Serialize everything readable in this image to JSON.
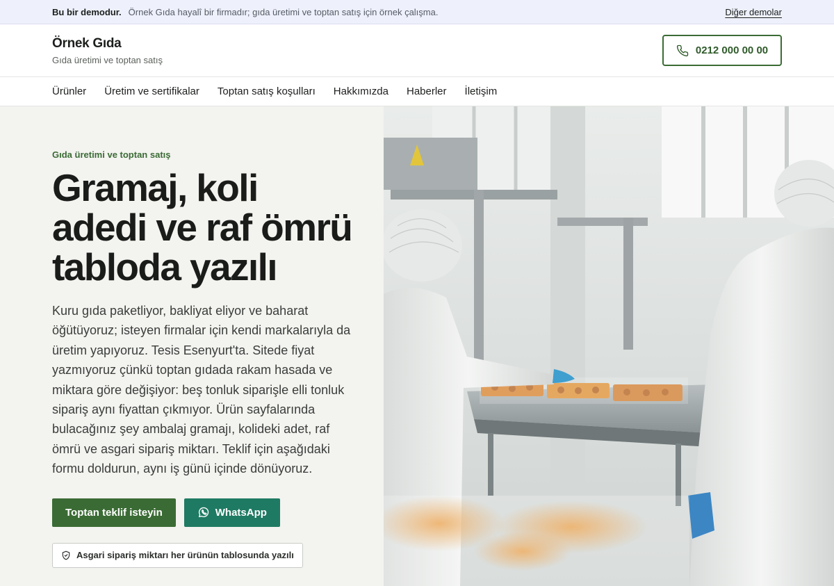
{
  "demo_bar": {
    "label": "Bu bir demodur.",
    "note": "Örnek Gıda hayalî bir firmadır; gıda üretimi ve toptan satış için örnek çalışma.",
    "link": "Diğer demolar"
  },
  "header": {
    "brand_name": "Örnek Gıda",
    "brand_tagline": "Gıda üretimi ve toptan satış",
    "phone": "0212 000 00 00",
    "phone_icon": "phone-icon"
  },
  "nav": {
    "items": [
      {
        "label": "Ürünler"
      },
      {
        "label": "Üretim ve sertifikalar"
      },
      {
        "label": "Toptan satış koşulları"
      },
      {
        "label": "Hakkımızda"
      },
      {
        "label": "Haberler"
      },
      {
        "label": "İletişim"
      }
    ]
  },
  "hero": {
    "eyebrow": "Gıda üretimi ve toptan satış",
    "headline": "Gramaj, koli adedi ve raf ömrü tabloda yazılı",
    "lead": "Kuru gıda paketliyor, bakliyat eliyor ve baharat öğütüyoruz; isteyen firmalar için kendi markalarıyla da üretim yapıyoruz. Tesis Esenyurt'ta. Sitede fiyat yazmıyoruz çünkü toptan gıdada rakam hasada ve miktara göre değişiyor: beş tonluk siparişle elli tonluk sipariş aynı fiyattan çıkmıyor. Ürün sayfalarında bulacağınız şey ambalaj gramajı, kolideki adet, raf ömrü ve asgari sipariş miktarı. Teklif için aşağıdaki formu doldurun, aynı iş günü içinde dönüyoruz.",
    "cta_primary": "Toptan teklif isteyin",
    "cta_whatsapp": "WhatsApp",
    "badge": "Asgari sipariş miktarı her ürünün tablosunda yazılı",
    "image_subject": "factory-workers-production-line-photo"
  },
  "colors": {
    "brand_green": "#3a6b34",
    "whatsapp_teal": "#1f7a63",
    "demo_bar_bg": "#eef1fb",
    "hero_bg": "#f3f3f0"
  }
}
